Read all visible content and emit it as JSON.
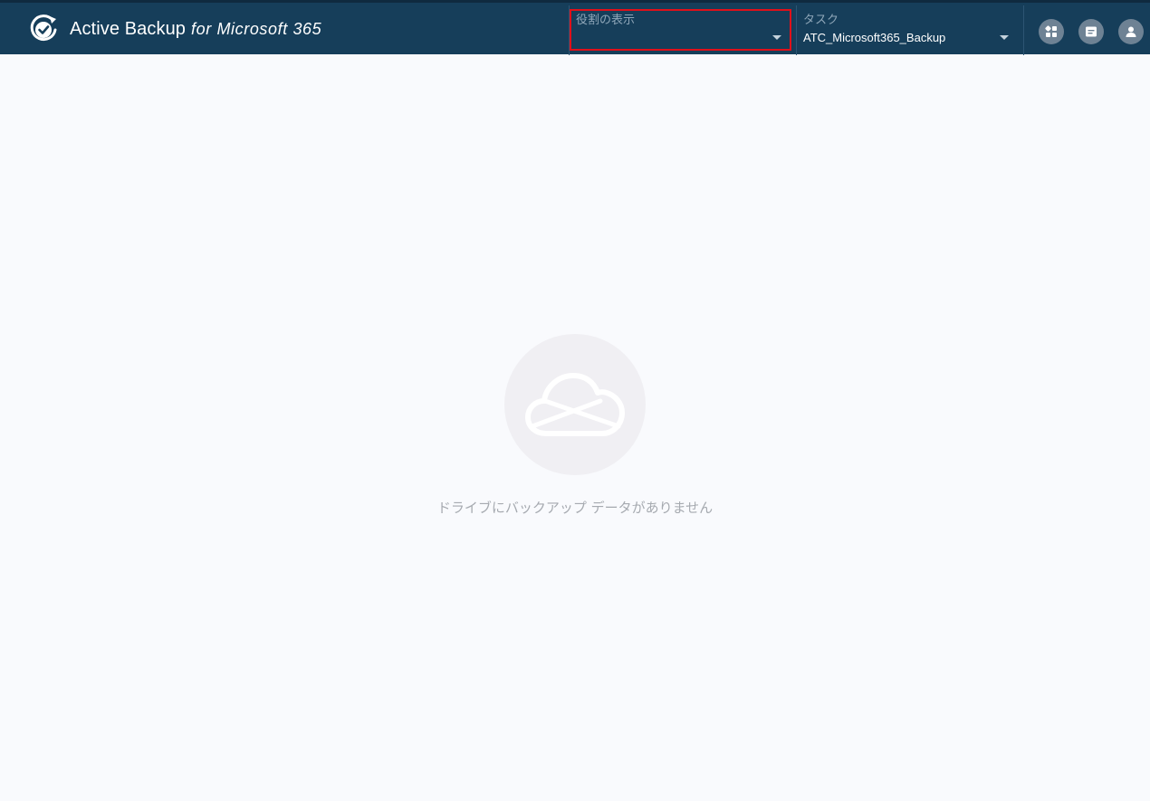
{
  "header": {
    "app_name": "Active Backup",
    "app_suffix": "for Microsoft 365",
    "role_selector": {
      "label": "役割の表示",
      "value": ""
    },
    "task_selector": {
      "label": "タスク",
      "value": "ATC_Microsoft365_Backup"
    },
    "icons": [
      "apps-icon",
      "message-icon",
      "user-icon"
    ]
  },
  "main": {
    "empty_icon": "onedrive-cloud-icon",
    "empty_message": "ドライブにバックアップ データがありません"
  },
  "colors": {
    "topbar": "#163e5a",
    "highlight": "#e0101a",
    "background": "#f9fafd"
  }
}
